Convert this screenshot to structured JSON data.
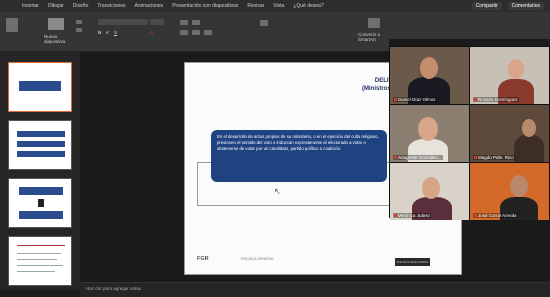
{
  "ribbon": {
    "tabs": [
      "Insertar",
      "Dibujar",
      "Diseño",
      "Transiciones",
      "Animaciones",
      "Presentación con diapositivas",
      "Revisar",
      "Vista",
      "¿Qué desea?"
    ],
    "share_label": "Compartir",
    "comments_label": "Comentarios",
    "new_slide_label": "Nueva diapositiva",
    "convert_label": "Convertir a SmartArt"
  },
  "slide": {
    "title_line1": "DELITOS ELECTORALES",
    "title_line2": "(Ministros de Culto Religioso)",
    "body": "En el desarrollo de actos propios de su ministerio, o en el ejercicio del culto religioso, presionen el sentido del voto o induzcan expresamente al electorado a votar o abstenerse de votar por un candidato, partido político o coalición.",
    "logo_left": "FGR",
    "logo_sub": "FISCALÍA GENERAL",
    "logo_right": "FISCALÍA ELECTORAL"
  },
  "notes_placeholder": "Haz clic para agregar notas",
  "participants": [
    {
      "name": "Daniel Díaz Olmos"
    },
    {
      "name": "Rosario Domínguez"
    },
    {
      "name": "Anagrette González..."
    },
    {
      "name": "Magdo Pdte. Rico"
    },
    {
      "name": "Verónica Juárez"
    },
    {
      "name": "José Corral Arreola"
    }
  ],
  "colors": {
    "slide_box": "#1f4380",
    "title": "#1f2d5a",
    "accent": "#e06a2c"
  }
}
